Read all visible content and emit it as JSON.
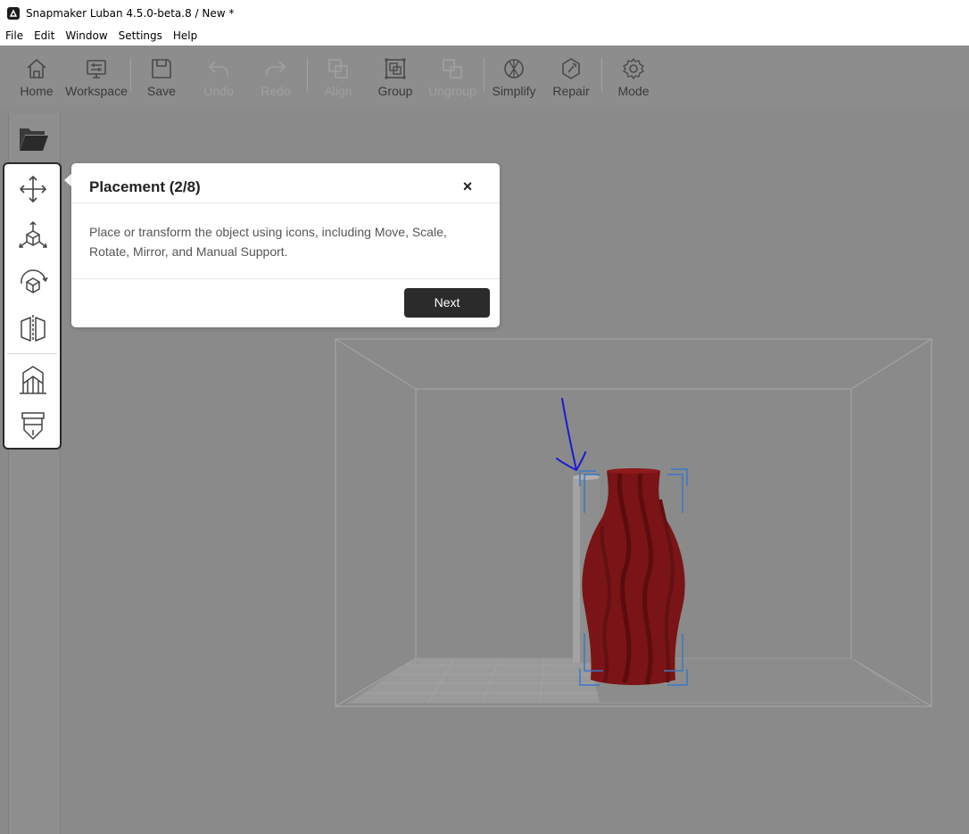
{
  "window": {
    "title": "Snapmaker Luban 4.5.0-beta.8 / New *"
  },
  "menu": [
    "File",
    "Edit",
    "Window",
    "Settings",
    "Help"
  ],
  "toolbar": {
    "home": "Home",
    "workspace": "Workspace",
    "save": "Save",
    "undo": "Undo",
    "redo": "Redo",
    "align": "Align",
    "group": "Group",
    "ungroup": "Ungroup",
    "simplify": "Simplify",
    "repair": "Repair",
    "mode": "Mode"
  },
  "left_tools": {
    "open": "folder-open-icon",
    "move": "move-icon",
    "scale": "scale-icon",
    "rotate": "rotate-icon",
    "mirror": "mirror-icon",
    "support": "manual-support-icon",
    "extruder": "extruder-icon"
  },
  "guide": {
    "title": "Placement (2/8)",
    "close": "×",
    "body": "Place or transform the object using icons, including Move, Scale, Rotate, Mirror, and Manual Support.",
    "next": "Next"
  },
  "colors": {
    "model": "#7a1416",
    "annotation_arrow": "#1a1ad6",
    "selection_bracket": "#3a78c4"
  }
}
